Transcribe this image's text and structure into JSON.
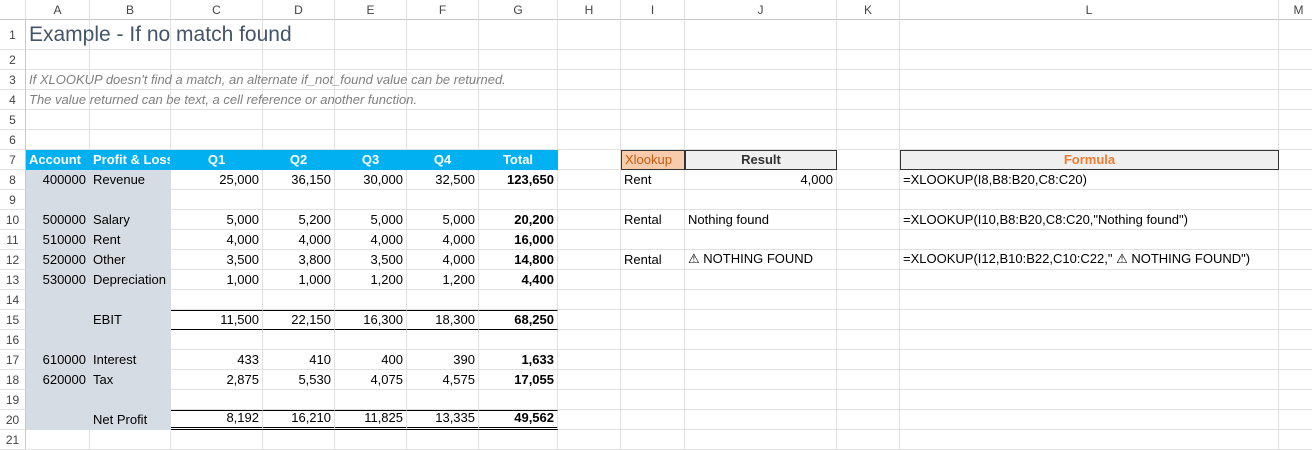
{
  "columns": [
    "A",
    "B",
    "C",
    "D",
    "E",
    "F",
    "G",
    "H",
    "I",
    "J",
    "K",
    "L",
    "M"
  ],
  "rows": [
    "1",
    "2",
    "3",
    "4",
    "5",
    "6",
    "7",
    "8",
    "9",
    "10",
    "11",
    "12",
    "13",
    "14",
    "15",
    "16",
    "17",
    "18",
    "19",
    "20",
    "21"
  ],
  "cells": {
    "A1": "Example - If no match found",
    "A3": "If XLOOKUP doesn't find a match, an alternate if_not_found value can be returned.",
    "A4": "The value returned can be text, a cell reference or another function.",
    "A7": "Account",
    "B7": "Profit & Loss",
    "C7": "Q1",
    "D7": "Q2",
    "E7": "Q3",
    "F7": "Q4",
    "G7": "Total",
    "I7": "Xlookup",
    "J7": "Result",
    "L7": "Formula",
    "A8": "400000",
    "B8": "Revenue",
    "C8": "25,000",
    "D8": "36,150",
    "E8": "30,000",
    "F8": "32,500",
    "G8": "123,650",
    "I8": "Rent",
    "J8": "4,000",
    "L8": "=XLOOKUP(I8,B8:B20,C8:C20)",
    "A10": "500000",
    "B10": "Salary",
    "C10": "5,000",
    "D10": "5,200",
    "E10": "5,000",
    "F10": "5,000",
    "G10": "20,200",
    "I10": "Rental",
    "J10": "Nothing found",
    "L10": "=XLOOKUP(I10,B8:B20,C8:C20,\"Nothing found\")",
    "A11": "510000",
    "B11": "Rent",
    "C11": "4,000",
    "D11": "4,000",
    "E11": "4,000",
    "F11": "4,000",
    "G11": "16,000",
    "A12": "520000",
    "B12": "Other",
    "C12": "3,500",
    "D12": "3,800",
    "E12": "3,500",
    "F12": "4,000",
    "G12": "14,800",
    "I12": "Rental",
    "J12": "⚠ NOTHING FOUND",
    "L12": "=XLOOKUP(I12,B10:B22,C10:C22,\" ⚠ NOTHING FOUND\")",
    "A13": "530000",
    "B13": "Depreciation",
    "C13": "1,000",
    "D13": "1,000",
    "E13": "1,200",
    "F13": "1,200",
    "G13": "4,400",
    "B15": "EBIT",
    "C15": "11,500",
    "D15": "22,150",
    "E15": "16,300",
    "F15": "18,300",
    "G15": "68,250",
    "A17": "610000",
    "B17": "Interest",
    "C17": "433",
    "D17": "410",
    "E17": "400",
    "F17": "390",
    "G17": "1,633",
    "A18": "620000",
    "B18": "Tax",
    "C18": "2,875",
    "D18": "5,530",
    "E18": "4,075",
    "F18": "4,575",
    "G18": "17,055",
    "B20": "Net Profit",
    "C20": "8,192",
    "D20": "16,210",
    "E20": "11,825",
    "F20": "13,335",
    "G20": "49,562"
  },
  "colors": {
    "header_fill": "#00b0f0",
    "label_fill": "#d6dce4",
    "xlookup_fill": "#f8cbad",
    "formula_text": "#ed7d31"
  }
}
